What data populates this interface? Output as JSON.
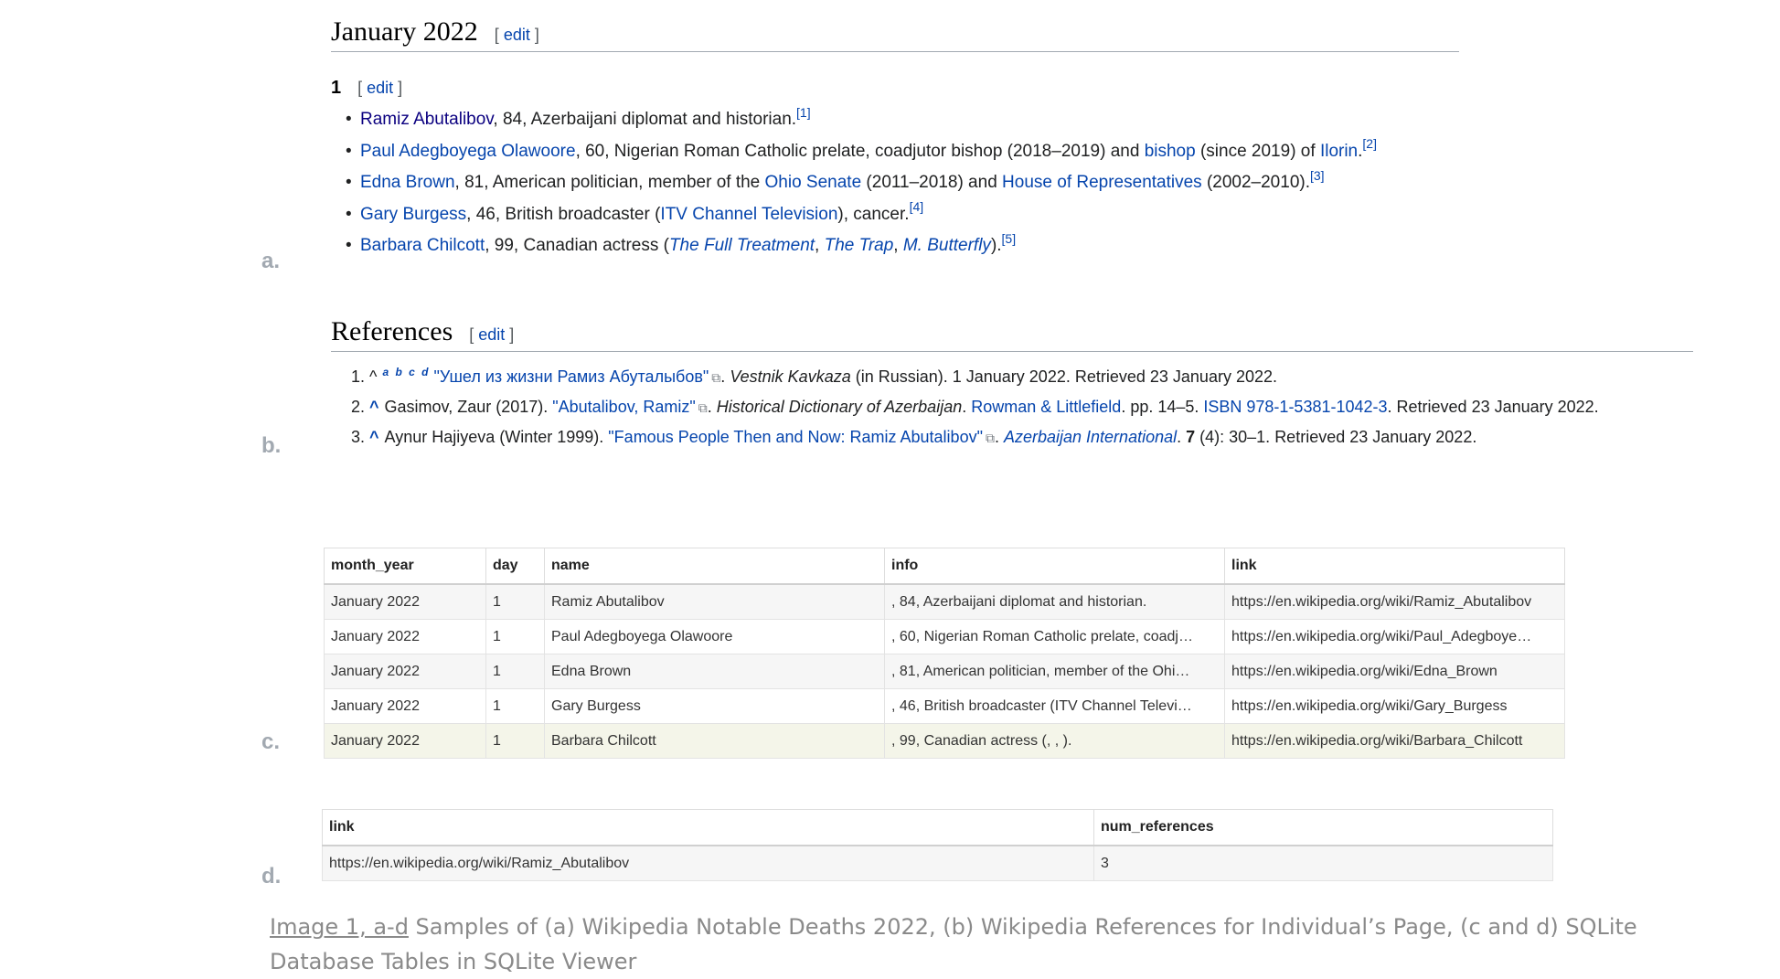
{
  "panel_letters": [
    "a.",
    "b.",
    "c.",
    "d."
  ],
  "section_a": {
    "heading": "January 2022",
    "edit_label": "edit",
    "day_heading": "1",
    "deaths": [
      {
        "name": "Ramiz Abutalibov",
        "rest": ", 84, Azerbaijani diplomat and historian.",
        "ref": "[1]"
      },
      {
        "name": "Paul Adegboyega Olawoore",
        "rest1": ", 60, Nigerian Roman Catholic prelate, coadjutor bishop (2018–2019) and ",
        "link2": "bishop",
        "rest2": " (since 2019) of ",
        "link3": "Ilorin",
        "rest3": ".",
        "ref": "[2]"
      },
      {
        "name": "Edna Brown",
        "rest1": ", 81, American politician, member of the ",
        "link2": "Ohio Senate",
        "rest2": " (2011–2018) and ",
        "link3": "House of Representatives",
        "rest3": " (2002–2010).",
        "ref": "[3]"
      },
      {
        "name": "Gary Burgess",
        "rest1": ", 46, British broadcaster (",
        "link2": "ITV Channel Television",
        "rest2": "), cancer.",
        "ref": "[4]"
      },
      {
        "name": "Barbara Chilcott",
        "rest1": ", 99, Canadian actress (",
        "link2": "The Full Treatment",
        "sep1": ", ",
        "link3": "The Trap",
        "sep2": ", ",
        "link4": "M. Butterfly",
        "rest2": ").",
        "ref": "[5]"
      }
    ]
  },
  "section_b": {
    "heading": "References",
    "edit_label": "edit",
    "refs": [
      {
        "caret": "^",
        "backlinks": "a b c d",
        "title": "\"Ушел из жизни Рамиз Абуталыбов\"",
        "sep": ". ",
        "work": "Vestnik Kavkaza",
        "rest": " (in Russian). 1 January 2022. Retrieved 23 January 2022."
      },
      {
        "caret": "^",
        "author": "Gasimov, Zaur (2017). ",
        "title": "\"Abutalibov, Ramiz\"",
        "sep": ". ",
        "work": "Historical Dictionary of Azerbaijan",
        "sep2": ". ",
        "publisher": "Rowman & Littlefield",
        "rest1": ". pp. 14–5. ",
        "isbn": "ISBN 978-1-5381-1042-3",
        "rest2": ". Retrieved 23 January 2022."
      },
      {
        "caret": "^",
        "author": "Aynur Hajiyeva (Winter 1999). ",
        "title": "\"Famous People Then and Now: Ramiz Abutalibov\"",
        "sep": ". ",
        "work": "Azerbaijan International",
        "sep2": ". ",
        "volume": "7",
        "rest": " (4): 30–1. Retrieved 23 January 2022."
      }
    ]
  },
  "table_c": {
    "columns": [
      "month_year",
      "day",
      "name",
      "info",
      "link"
    ],
    "rows": [
      [
        "January 2022",
        "1",
        "Ramiz Abutalibov",
        ", 84, Azerbaijani diplomat and historian.",
        "https://en.wikipedia.org/wiki/Ramiz_Abutalibov"
      ],
      [
        "January 2022",
        "1",
        "Paul Adegboyega Olawoore",
        ", 60, Nigerian Roman Catholic prelate, coadj…",
        "https://en.wikipedia.org/wiki/Paul_Adegboye…"
      ],
      [
        "January 2022",
        "1",
        "Edna Brown",
        ", 81, American politician, member of the Ohi…",
        "https://en.wikipedia.org/wiki/Edna_Brown"
      ],
      [
        "January 2022",
        "1",
        "Gary Burgess",
        ", 46, British broadcaster (ITV Channel Televi…",
        "https://en.wikipedia.org/wiki/Gary_Burgess"
      ],
      [
        "January 2022",
        "1",
        "Barbara Chilcott",
        ", 99, Canadian actress (, , ).",
        "https://en.wikipedia.org/wiki/Barbara_Chilcott"
      ]
    ]
  },
  "table_d": {
    "columns": [
      "link",
      "num_references"
    ],
    "rows": [
      [
        "https://en.wikipedia.org/wiki/Ramiz_Abutalibov",
        "3"
      ]
    ]
  },
  "caption": {
    "ref": "Image 1, a-d",
    "text": " Samples of (a) Wikipedia Notable Deaths 2022, (b) Wikipedia References for Individual’s Page, (c and d) SQLite Database Tables in SQLite Viewer"
  }
}
